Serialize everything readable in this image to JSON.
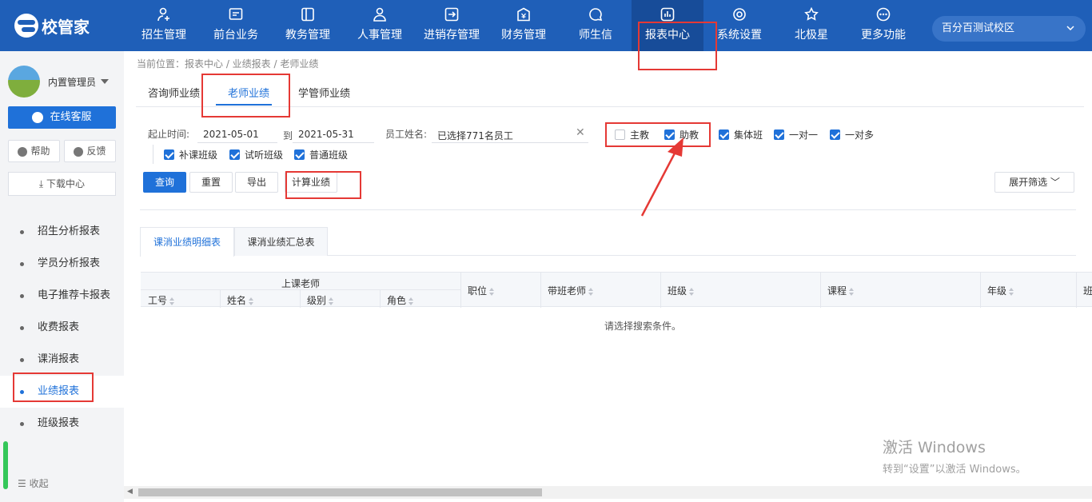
{
  "app": {
    "logo_text": "校管家"
  },
  "nav": [
    {
      "label": "招生管理",
      "icon": "user-add-icon"
    },
    {
      "label": "前台业务",
      "icon": "front-desk-icon"
    },
    {
      "label": "教务管理",
      "icon": "book-icon"
    },
    {
      "label": "人事管理",
      "icon": "person-icon"
    },
    {
      "label": "进销存管理",
      "icon": "inventory-icon"
    },
    {
      "label": "财务管理",
      "icon": "finance-icon"
    },
    {
      "label": "师生信",
      "icon": "message-icon"
    },
    {
      "label": "报表中心",
      "icon": "chart-icon"
    },
    {
      "label": "系统设置",
      "icon": "gear-icon"
    },
    {
      "label": "北极星",
      "icon": "star-icon"
    },
    {
      "label": "更多功能",
      "icon": "more-icon"
    }
  ],
  "campus": "百分百测试校区",
  "sidebar": {
    "username": "内置管理员",
    "online_service": "在线客服",
    "help": "帮助",
    "feedback": "反馈",
    "download": "下载中心",
    "items": [
      "招生分析报表",
      "学员分析报表",
      "电子推荐卡报表",
      "收费报表",
      "课消报表",
      "业绩报表",
      "班级报表"
    ],
    "collapse": "收起"
  },
  "breadcrumb": "当前位置：报表中心 / 业绩报表 / 老师业绩",
  "tabs": [
    "咨询师业绩",
    "老师业绩",
    "学管师业绩"
  ],
  "filters": {
    "date_label": "起止时间:",
    "date_from": "2021-05-01",
    "date_to_label": "到",
    "date_to": "2021-05-31",
    "staff_label": "员工姓名:",
    "staff_value": "已选择771名员工",
    "roles": [
      {
        "label": "主教",
        "checked": false
      },
      {
        "label": "助教",
        "checked": true
      },
      {
        "label": "集体班",
        "checked": true
      },
      {
        "label": "一对一",
        "checked": true
      },
      {
        "label": "一对多",
        "checked": true
      }
    ],
    "class_types": [
      {
        "label": "补课班级",
        "checked": true
      },
      {
        "label": "试听班级",
        "checked": true
      },
      {
        "label": "普通班级",
        "checked": true
      }
    ]
  },
  "buttons": {
    "query": "查询",
    "reset": "重置",
    "export": "导出",
    "calc": "计算业绩",
    "expand": "展开筛选"
  },
  "subtabs": [
    "课消业绩明细表",
    "课消业绩汇总表"
  ],
  "table": {
    "group_header": "上课老师",
    "sub_headers": [
      "工号",
      "姓名",
      "级别",
      "角色"
    ],
    "headers": [
      "职位",
      "带班老师",
      "班级",
      "课程",
      "年级",
      "班"
    ],
    "empty": "请选择搜索条件。"
  },
  "watermark": {
    "line1": "激活 Windows",
    "line2": "转到“设置”以激活 Windows。"
  }
}
